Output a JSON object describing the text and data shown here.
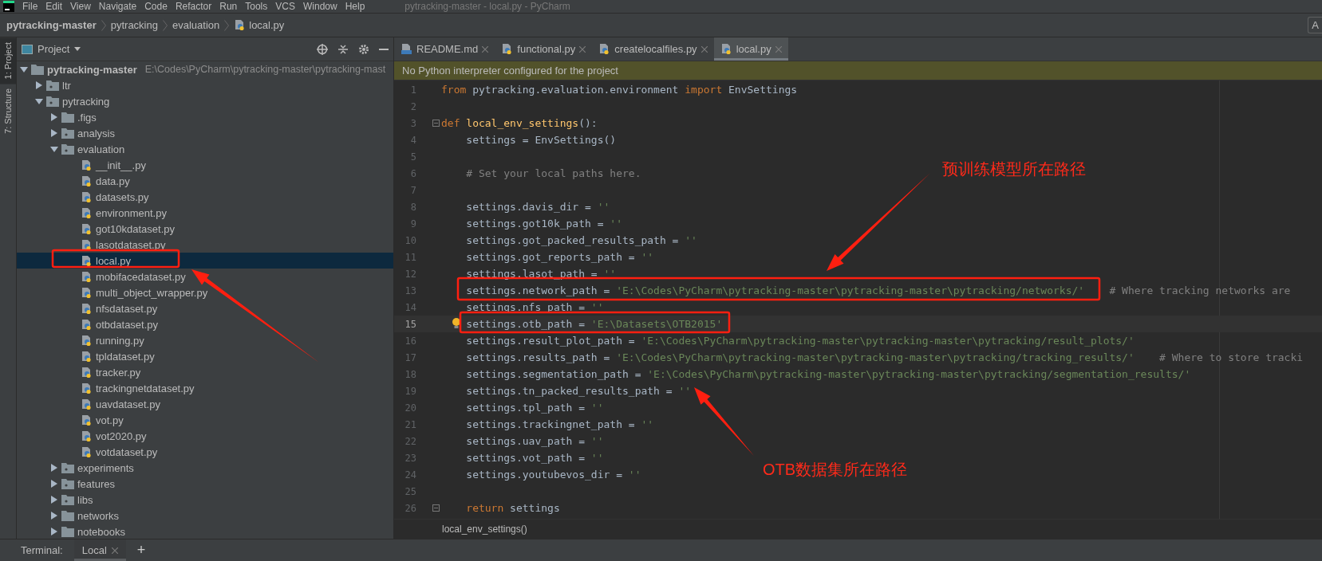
{
  "menu": {
    "items": [
      "File",
      "Edit",
      "View",
      "Navigate",
      "Code",
      "Refactor",
      "Run",
      "Tools",
      "VCS",
      "Window",
      "Help"
    ],
    "window_title": "pytracking-master - local.py - PyCharm"
  },
  "breadcrumb": {
    "items": [
      {
        "label": "pytracking-master",
        "kind": "project"
      },
      {
        "label": "pytracking",
        "kind": "folder"
      },
      {
        "label": "evaluation",
        "kind": "folder"
      },
      {
        "label": "local.py",
        "kind": "file"
      }
    ],
    "right_button": "A"
  },
  "tool_strip": [
    {
      "label": "1: Project",
      "selected": true
    },
    {
      "label": "7: Structure",
      "selected": false
    }
  ],
  "project": {
    "title": "Project",
    "tree": [
      {
        "kind": "root",
        "label": "pytracking-master",
        "path_hint": "E:\\Codes\\PyCharm\\pytracking-master\\pytracking-mast",
        "expanded": true,
        "selected": false,
        "children": [
          {
            "kind": "package",
            "label": "ltr",
            "expanded": false,
            "selected": false
          },
          {
            "kind": "package",
            "label": "pytracking",
            "expanded": true,
            "selected": false,
            "children": [
              {
                "kind": "folder",
                "label": ".figs",
                "expanded": false,
                "selected": false
              },
              {
                "kind": "package",
                "label": "analysis",
                "expanded": false,
                "selected": false
              },
              {
                "kind": "package",
                "label": "evaluation",
                "expanded": true,
                "selected": false,
                "children": [
                  {
                    "kind": "file",
                    "label": "__init__.py",
                    "selected": false
                  },
                  {
                    "kind": "file",
                    "label": "data.py",
                    "selected": false
                  },
                  {
                    "kind": "file",
                    "label": "datasets.py",
                    "selected": false
                  },
                  {
                    "kind": "file",
                    "label": "environment.py",
                    "selected": false
                  },
                  {
                    "kind": "file",
                    "label": "got10kdataset.py",
                    "selected": false
                  },
                  {
                    "kind": "file",
                    "label": "lasotdataset.py",
                    "selected": false
                  },
                  {
                    "kind": "file",
                    "label": "local.py",
                    "selected": true
                  },
                  {
                    "kind": "file",
                    "label": "mobifacedataset.py",
                    "selected": false
                  },
                  {
                    "kind": "file",
                    "label": "multi_object_wrapper.py",
                    "selected": false
                  },
                  {
                    "kind": "file",
                    "label": "nfsdataset.py",
                    "selected": false
                  },
                  {
                    "kind": "file",
                    "label": "otbdataset.py",
                    "selected": false
                  },
                  {
                    "kind": "file",
                    "label": "running.py",
                    "selected": false
                  },
                  {
                    "kind": "file",
                    "label": "tpldataset.py",
                    "selected": false
                  },
                  {
                    "kind": "file",
                    "label": "tracker.py",
                    "selected": false
                  },
                  {
                    "kind": "file",
                    "label": "trackingnetdataset.py",
                    "selected": false
                  },
                  {
                    "kind": "file",
                    "label": "uavdataset.py",
                    "selected": false
                  },
                  {
                    "kind": "file",
                    "label": "vot.py",
                    "selected": false
                  },
                  {
                    "kind": "file",
                    "label": "vot2020.py",
                    "selected": false
                  },
                  {
                    "kind": "file",
                    "label": "votdataset.py",
                    "selected": false
                  }
                ]
              },
              {
                "kind": "package",
                "label": "experiments",
                "expanded": false,
                "selected": false
              },
              {
                "kind": "package",
                "label": "features",
                "expanded": false,
                "selected": false
              },
              {
                "kind": "package",
                "label": "libs",
                "expanded": false,
                "selected": false
              },
              {
                "kind": "folder",
                "label": "networks",
                "expanded": false,
                "selected": false
              },
              {
                "kind": "folder",
                "label": "notebooks",
                "expanded": false,
                "selected": false
              }
            ]
          }
        ]
      }
    ]
  },
  "editor": {
    "tabs": [
      {
        "label": "README.md",
        "kind": "markdown",
        "selected": false
      },
      {
        "label": "functional.py",
        "kind": "python",
        "selected": false
      },
      {
        "label": "createlocalfiles.py",
        "kind": "python",
        "selected": false
      },
      {
        "label": "local.py",
        "kind": "python",
        "selected": true
      }
    ],
    "banner": "No Python interpreter configured for the project",
    "lines": [
      {
        "number": "1",
        "current": false,
        "fold": false,
        "tokens": [
          {
            "kind": "keyword",
            "text": "from"
          },
          {
            "kind": "plain",
            "text": " pytracking.evaluation.environment "
          },
          {
            "kind": "keyword",
            "text": "import"
          },
          {
            "kind": "plain",
            "text": " EnvSettings"
          }
        ]
      },
      {
        "number": "2",
        "current": false,
        "fold": false
      },
      {
        "number": "3",
        "current": false,
        "fold": true,
        "tokens": [
          {
            "kind": "keyword",
            "text": "def"
          },
          {
            "kind": "func",
            "text": " local_env_settings"
          },
          {
            "kind": "plain",
            "text": "():"
          }
        ]
      },
      {
        "number": "4",
        "current": false,
        "fold": false,
        "tokens": [
          {
            "kind": "plain",
            "text": "    settings = EnvSettings()"
          }
        ]
      },
      {
        "number": "5",
        "current": false,
        "fold": false
      },
      {
        "number": "6",
        "current": false,
        "fold": false,
        "tokens": [
          {
            "kind": "comment",
            "text": "    # Set your local paths here."
          }
        ]
      },
      {
        "number": "7",
        "current": false,
        "fold": false
      },
      {
        "number": "8",
        "current": false,
        "fold": false,
        "tokens": [
          {
            "kind": "plain",
            "text": "    settings.davis_dir = "
          },
          {
            "kind": "string",
            "text": "''"
          }
        ]
      },
      {
        "number": "9",
        "current": false,
        "fold": false,
        "tokens": [
          {
            "kind": "plain",
            "text": "    settings.got10k_path = "
          },
          {
            "kind": "string",
            "text": "''"
          }
        ]
      },
      {
        "number": "10",
        "current": false,
        "fold": false,
        "tokens": [
          {
            "kind": "plain",
            "text": "    settings.got_packed_results_path = "
          },
          {
            "kind": "string",
            "text": "''"
          }
        ]
      },
      {
        "number": "11",
        "current": false,
        "fold": false,
        "tokens": [
          {
            "kind": "plain",
            "text": "    settings.got_reports_path = "
          },
          {
            "kind": "string",
            "text": "''"
          }
        ]
      },
      {
        "number": "12",
        "current": false,
        "fold": false,
        "tokens": [
          {
            "kind": "plain",
            "text": "    settings.lasot_path = "
          },
          {
            "kind": "string",
            "text": "''"
          }
        ]
      },
      {
        "number": "13",
        "current": false,
        "fold": false,
        "tokens": [
          {
            "kind": "plain",
            "text": "    settings.network_path = "
          },
          {
            "kind": "string",
            "text": "'E:\\Codes\\PyCharm\\pytracking-master\\pytracking-master\\pytracking/networks/'"
          },
          {
            "kind": "comment",
            "text": "# Where tracking networks are"
          }
        ]
      },
      {
        "number": "14",
        "current": false,
        "fold": false,
        "tokens": [
          {
            "kind": "plain",
            "text": "    settings.nfs_path = "
          },
          {
            "kind": "string",
            "text": "''"
          }
        ]
      },
      {
        "number": "15",
        "current": true,
        "fold": false,
        "tokens": [
          {
            "kind": "plain",
            "text": "    settings.otb_path = "
          },
          {
            "kind": "string",
            "text": "'E:\\Datasets\\OTB2015'"
          }
        ]
      },
      {
        "number": "16",
        "current": false,
        "fold": false,
        "tokens": [
          {
            "kind": "plain",
            "text": "    settings.result_plot_path = "
          },
          {
            "kind": "string",
            "text": "'E:\\Codes\\PyCharm\\pytracking-master\\pytracking-master\\pytracking/result_plots/'"
          }
        ]
      },
      {
        "number": "17",
        "current": false,
        "fold": false,
        "tokens": [
          {
            "kind": "plain",
            "text": "    settings.results_path = "
          },
          {
            "kind": "string",
            "text": "'E:\\Codes\\PyCharm\\pytracking-master\\pytracking-master\\pytracking/tracking_results/'"
          },
          {
            "kind": "comment",
            "text": "# Where to store tracki"
          }
        ]
      },
      {
        "number": "18",
        "current": false,
        "fold": false,
        "tokens": [
          {
            "kind": "plain",
            "text": "    settings.segmentation_path = "
          },
          {
            "kind": "string",
            "text": "'E:\\Codes\\PyCharm\\pytracking-master\\pytracking-master\\pytracking/segmentation_results/'"
          }
        ]
      },
      {
        "number": "19",
        "current": false,
        "fold": false,
        "tokens": [
          {
            "kind": "plain",
            "text": "    settings.tn_packed_results_path = "
          },
          {
            "kind": "string",
            "text": "''"
          }
        ]
      },
      {
        "number": "20",
        "current": false,
        "fold": false,
        "tokens": [
          {
            "kind": "plain",
            "text": "    settings.tpl_path = "
          },
          {
            "kind": "string",
            "text": "''"
          }
        ]
      },
      {
        "number": "21",
        "current": false,
        "fold": false,
        "tokens": [
          {
            "kind": "plain",
            "text": "    settings.trackingnet_path = "
          },
          {
            "kind": "string",
            "text": "''"
          }
        ]
      },
      {
        "number": "22",
        "current": false,
        "fold": false,
        "tokens": [
          {
            "kind": "plain",
            "text": "    settings.uav_path = "
          },
          {
            "kind": "string",
            "text": "''"
          }
        ]
      },
      {
        "number": "23",
        "current": false,
        "fold": false,
        "tokens": [
          {
            "kind": "plain",
            "text": "    settings.vot_path = "
          },
          {
            "kind": "string",
            "text": "''"
          }
        ]
      },
      {
        "number": "24",
        "current": false,
        "fold": false,
        "tokens": [
          {
            "kind": "plain",
            "text": "    settings.youtubevos_dir = "
          },
          {
            "kind": "string",
            "text": "''"
          }
        ]
      },
      {
        "number": "25",
        "current": false,
        "fold": false
      },
      {
        "number": "26",
        "current": false,
        "fold": true,
        "tokens": [
          {
            "kind": "keyword",
            "text": "    return"
          },
          {
            "kind": "plain",
            "text": " settings"
          }
        ]
      }
    ],
    "footer": "local_env_settings()"
  },
  "terminal": {
    "label": "Terminal:",
    "tabs": [
      {
        "label": "Local",
        "selected": true
      }
    ],
    "add": "+"
  },
  "annotations": [
    {
      "kind": "box"
    },
    {
      "kind": "box"
    },
    {
      "kind": "box"
    },
    {
      "kind": "arrow"
    },
    {
      "kind": "arrow"
    },
    {
      "kind": "arrow"
    },
    {
      "kind": "label",
      "text": "预训练模型所在路径"
    },
    {
      "kind": "label",
      "text": "OTB数据集所在路径"
    }
  ]
}
